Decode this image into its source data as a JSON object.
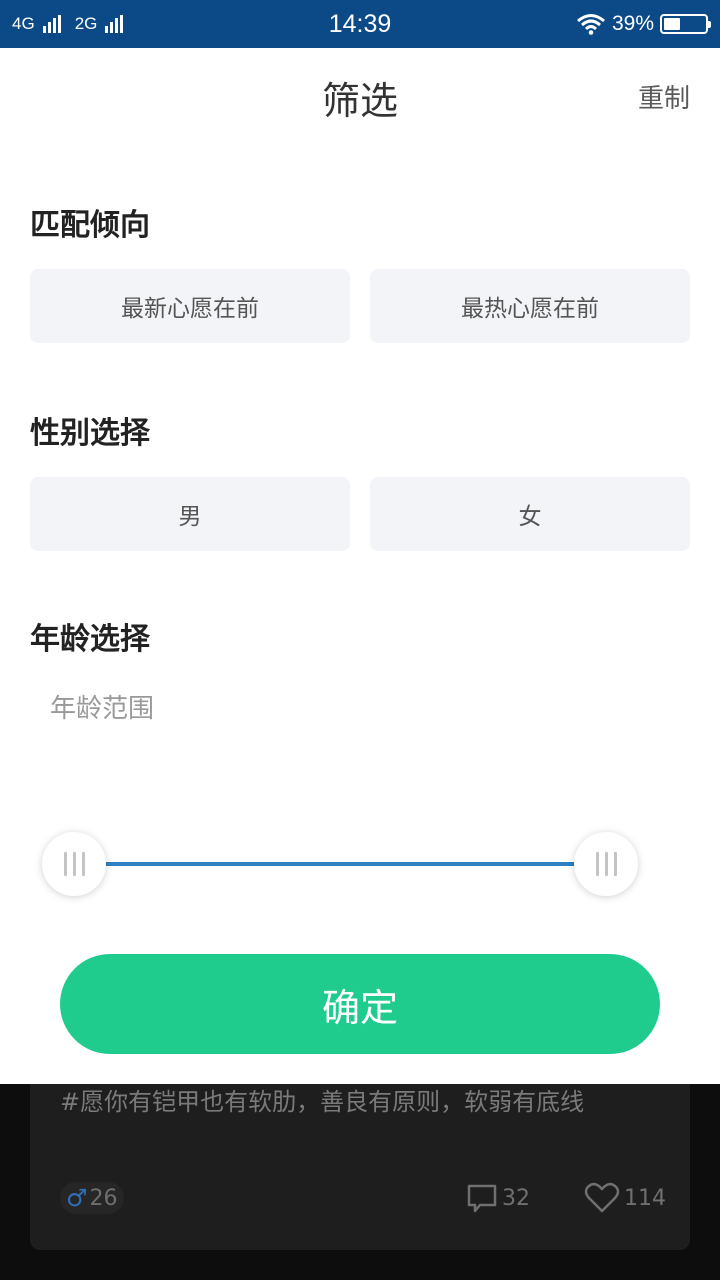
{
  "status_bar": {
    "net1": "4G",
    "net2": "2G",
    "time": "14:39",
    "battery": "39%",
    "battery_level": 0.39,
    "icons": [
      "signal-icon",
      "wifi-icon",
      "battery-icon"
    ]
  },
  "header": {
    "title": "筛选",
    "reset_label": "重制"
  },
  "match": {
    "title": "匹配倾向",
    "options": [
      "最新心愿在前",
      "最热心愿在前"
    ]
  },
  "gender": {
    "title": "性别选择",
    "options": [
      "男",
      "女"
    ]
  },
  "age": {
    "title": "年龄选择",
    "range_label": "年龄范围",
    "range_min": 0,
    "range_max": 1
  },
  "confirm_label": "确定",
  "background_card": {
    "text": "#愿你有铠甲也有软肋，善良有原则，软弱有底线",
    "gender_symbol": "♂",
    "gender_count": "26",
    "comments": "32",
    "likes": "114"
  },
  "colors": {
    "status_bar": "#0b4a86",
    "accent": "#1fcc8e",
    "slider": "#2f7fc1"
  }
}
